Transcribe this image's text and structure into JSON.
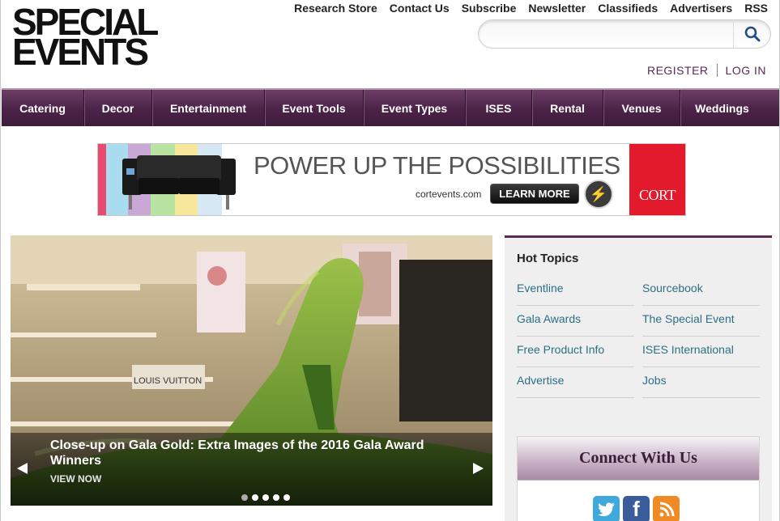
{
  "logo": {
    "line1": "SPECIAL",
    "line2": "EVENTS"
  },
  "top_links": [
    "Research Store",
    "Contact Us",
    "Subscribe",
    "Newsletter",
    "Classifieds",
    "Advertisers",
    "RSS"
  ],
  "search": {
    "value": "",
    "placeholder": ""
  },
  "account": {
    "register": "REGISTER",
    "login": "LOG IN"
  },
  "nav": [
    "Catering",
    "Decor",
    "Entertainment",
    "Event Tools",
    "Event Types",
    "ISES",
    "Rental",
    "Venues",
    "Weddings"
  ],
  "ad": {
    "headline": "POWER UP THE POSSIBILITIES",
    "url": "cortevents.com",
    "cta": "LEARN MORE",
    "badge": "POWERED",
    "brand": "CORT"
  },
  "slideshow": {
    "title": "Close-up on Gala Gold: Extra Images of the 2016 Gala Award Winners",
    "link": "VIEW NOW",
    "sign": "LOUIS VUITTON",
    "dots": 5,
    "active_dot": 0
  },
  "hot_topics": {
    "title": "Hot Topics",
    "left": [
      "Eventline",
      "Gala Awards",
      "Free Product Info",
      "Advertise"
    ],
    "right": [
      "Sourcebook",
      "The Special Event",
      "ISES International",
      "Jobs"
    ]
  },
  "connect": {
    "title": "Connect With Us",
    "icons": [
      "twitter-icon",
      "facebook-icon",
      "rss-icon"
    ]
  },
  "colors": {
    "brand_purple": "#4b2347",
    "link_teal": "#2c6f84",
    "ad_red": "#e21a2c"
  }
}
